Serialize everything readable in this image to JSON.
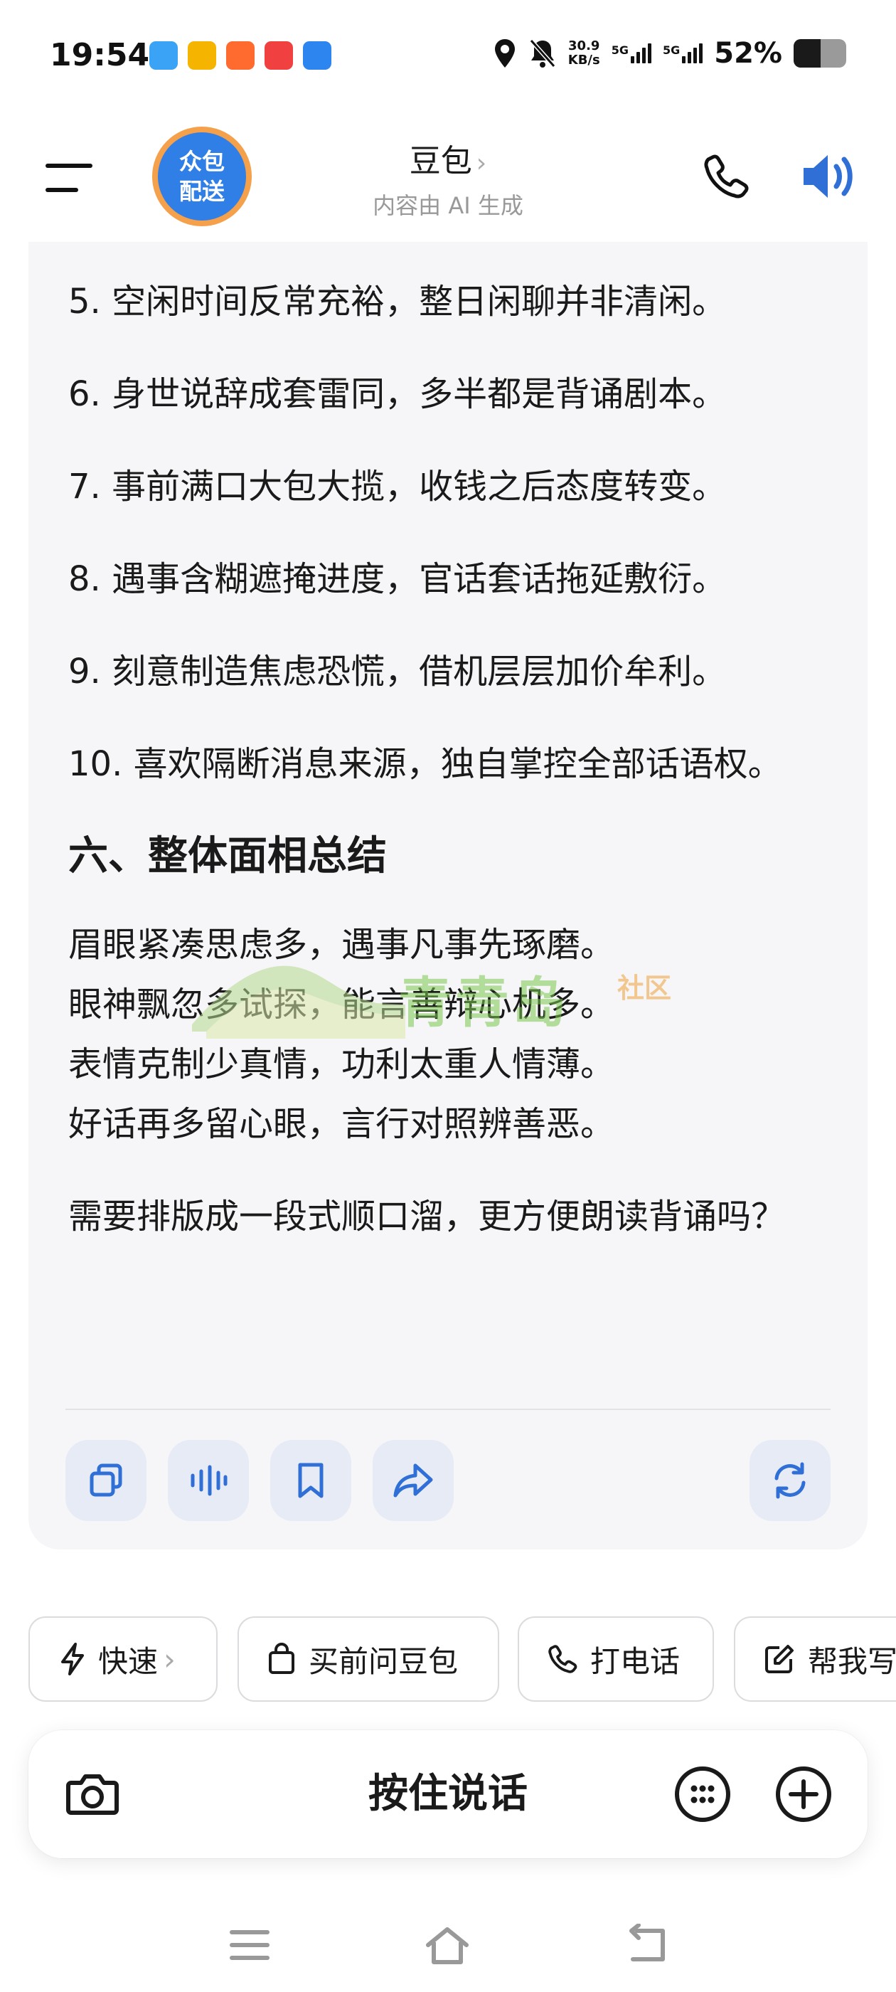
{
  "status_bar": {
    "time": "19:54",
    "speed_value": "30.9",
    "speed_unit": "KB/s",
    "sim1": "5G",
    "sim2": "5G",
    "battery": "52%",
    "battery_level": 0.52,
    "app_icon_colors": [
      "#3aa3f5",
      "#f5b400",
      "#ff6a2e",
      "#f04040",
      "#2d86f0"
    ]
  },
  "header": {
    "avatar_line1": "众包",
    "avatar_line2": "配送",
    "title": "豆包",
    "title_chevron": "›",
    "subtitle": "内容由 AI 生成"
  },
  "message": {
    "list": [
      {
        "num": "5.",
        "text": "空闲时间反常充裕，整日闲聊并非清闲。"
      },
      {
        "num": "6.",
        "text": "身世说辞成套雷同，多半都是背诵剧本。"
      },
      {
        "num": "7.",
        "text": "事前满口大包大揽，收钱之后态度转变。"
      },
      {
        "num": "8.",
        "text": "遇事含糊遮掩进度，官话套话拖延敷衍。"
      },
      {
        "num": "9.",
        "text": "刻意制造焦虑恐慌，借机层层加价牟利。"
      },
      {
        "num": "10.",
        "text": "喜欢隔断消息来源，独自掌控全部话语权。"
      }
    ],
    "section_title": "六、整体面相总结",
    "poem": [
      "眉眼紧凑思虑多，遇事凡事先琢磨。",
      "眼神飘忽多试探，能言善辩心机多。",
      "表情克制少真情，功利太重人情薄。",
      "好话再多留心眼，言行对照辨善恶。"
    ],
    "closing": "需要排版成一段式顺口溜，更方便朗读背诵吗？"
  },
  "watermark": {
    "text": "青青岛",
    "sub": "社区"
  },
  "message_actions": [
    "copy-icon",
    "voice-icon",
    "bookmark-icon",
    "share-icon",
    "regenerate-icon"
  ],
  "quick_chips": {
    "fast": "快速",
    "fast_chevron": "›",
    "ask_before_buy": "买前问豆包",
    "call": "打电话",
    "help_write": "帮我写"
  },
  "input_bar": {
    "hold_to_talk": "按住说话"
  },
  "colors": {
    "accent": "#2f6fd6",
    "card_bg": "#f6f6f8",
    "action_bg": "#e6ebf6"
  }
}
